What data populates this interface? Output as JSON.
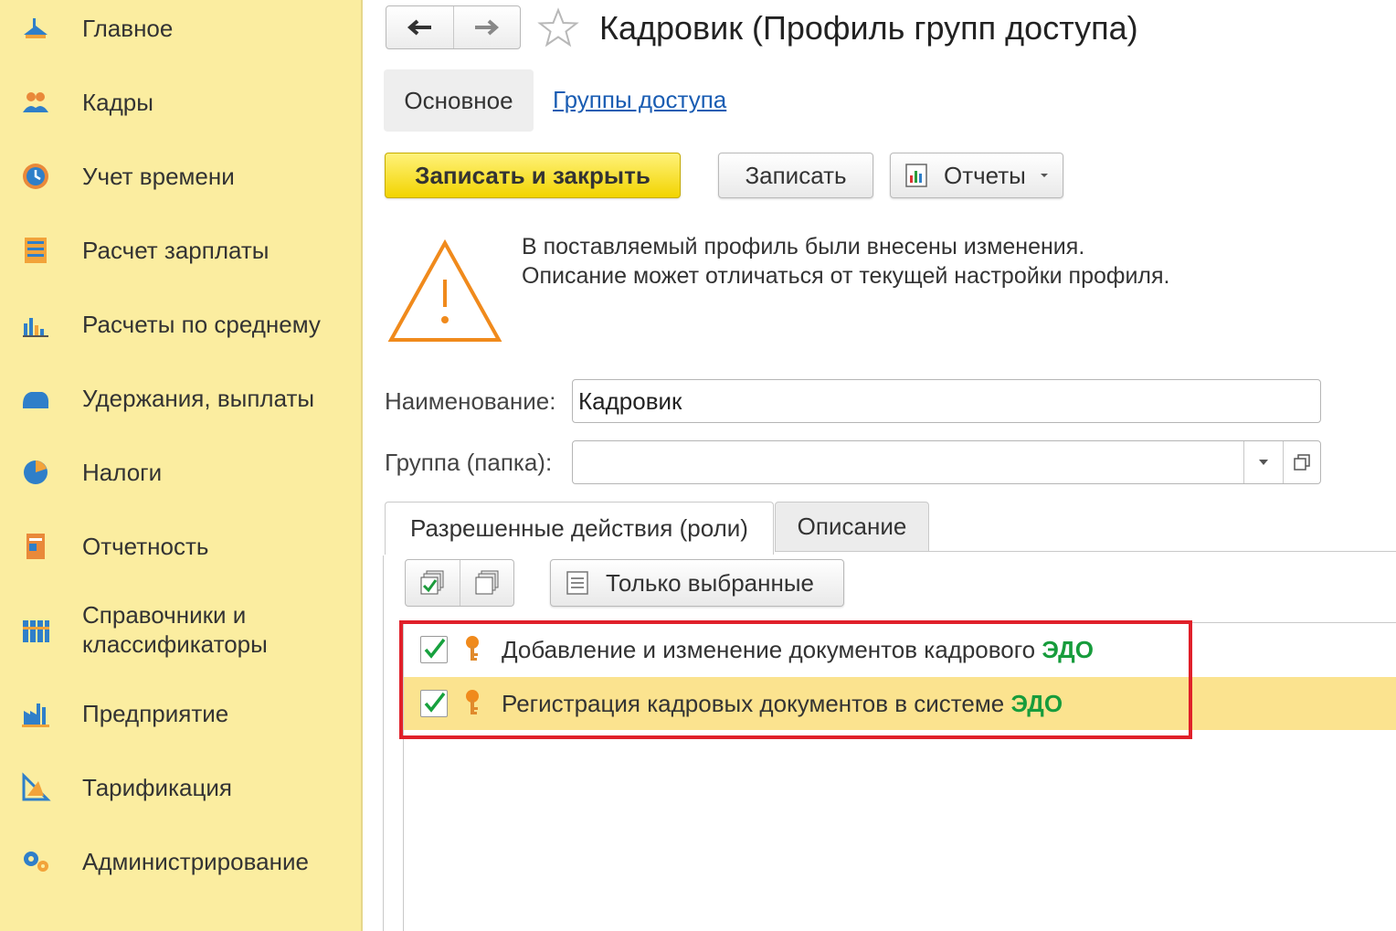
{
  "sidebar": {
    "items": [
      {
        "label": "Главное",
        "icon": "home-icon"
      },
      {
        "label": "Кадры",
        "icon": "people-icon"
      },
      {
        "label": "Учет времени",
        "icon": "clock-icon"
      },
      {
        "label": "Расчет зарплаты",
        "icon": "abacus-icon"
      },
      {
        "label": "Расчеты по среднему",
        "icon": "bar-chart-icon"
      },
      {
        "label": "Удержания, выплаты",
        "icon": "wallet-icon"
      },
      {
        "label": "Налоги",
        "icon": "pie-chart-icon"
      },
      {
        "label": "Отчетность",
        "icon": "report-icon"
      },
      {
        "label_line1": "Справочники и",
        "label_line2": "классификаторы",
        "icon": "books-icon"
      },
      {
        "label": "Предприятие",
        "icon": "factory-icon"
      },
      {
        "label": "Тарификация",
        "icon": "ruler-icon"
      },
      {
        "label": "Администрирование",
        "icon": "gears-icon"
      }
    ]
  },
  "header": {
    "title": "Кадровик (Профиль групп доступа)"
  },
  "form_tabs": {
    "main": "Основное",
    "groups_link": "Группы доступа"
  },
  "toolbar": {
    "save_close": "Записать и закрыть",
    "save": "Записать",
    "reports": "Отчеты"
  },
  "warning": {
    "line1": "В поставляемый профиль были внесены изменения.",
    "line2": "Описание может отличаться от текущей настройки профиля."
  },
  "fields": {
    "name_label": "Наименование:",
    "name_value": "Кадровик",
    "group_label": "Группа (папка):",
    "group_value": ""
  },
  "inner_tabs": {
    "roles": "Разрешенные действия (роли)",
    "description": "Описание"
  },
  "roles_toolbar": {
    "only_selected": "Только выбранные"
  },
  "roles": [
    {
      "text": "Добавление и изменение документов кадрового ",
      "highlight": "ЭДО",
      "checked": true
    },
    {
      "text": "Регистрация кадровых документов в системе ",
      "highlight": "ЭДО",
      "checked": true
    }
  ],
  "colors": {
    "sidebar_bg": "#fbeda0",
    "primary_button": "#f5d90a",
    "link": "#1a5db3",
    "highlight_text": "#179c3c",
    "selected_row": "#fbe38f",
    "annotation_box": "#e0202a",
    "warning": "#f08a1c"
  }
}
